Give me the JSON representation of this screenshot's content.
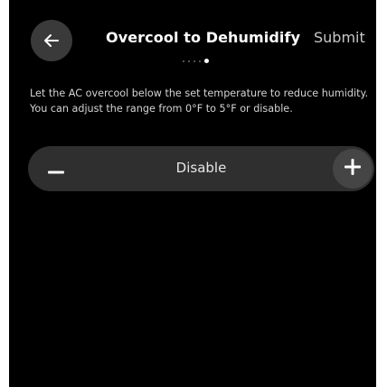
{
  "header": {
    "back_icon": "arrow-left-icon",
    "title": "Overcool to Dehumidify",
    "submit_label": "Submit",
    "pagination": {
      "total": 5,
      "current": 5
    }
  },
  "description": {
    "line1": "Let the AC overcool below the set temperature to reduce humidity.",
    "line2": "You can adjust the range from 0°F to 5°F or disable."
  },
  "stepper": {
    "decrement_icon": "minus-icon",
    "increment_icon": "plus-icon",
    "value": "Disable"
  },
  "colors": {
    "screen_background": "#000000",
    "control_background": "#2f2f2f",
    "button_background": "#454545",
    "text_primary": "#ffffff"
  }
}
